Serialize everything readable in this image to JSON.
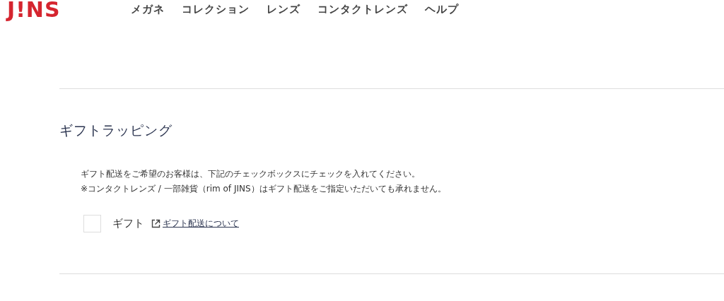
{
  "header": {
    "logo": "J!NS",
    "nav": [
      "メガネ",
      "コレクション",
      "レンズ",
      "コンタクトレンズ",
      "ヘルプ"
    ]
  },
  "section": {
    "title": "ギフトラッピング",
    "notes": [
      "ギフト配送をご希望のお客様は、下記のチェックボックスにチェックを入れてください。",
      "※コンタクトレンズ / 一部雑貨（rim of JINS）はギフト配送をご指定いただいても承れません。"
    ],
    "option": {
      "label": "ギフト",
      "checked": false,
      "link": "ギフト配送について"
    }
  }
}
